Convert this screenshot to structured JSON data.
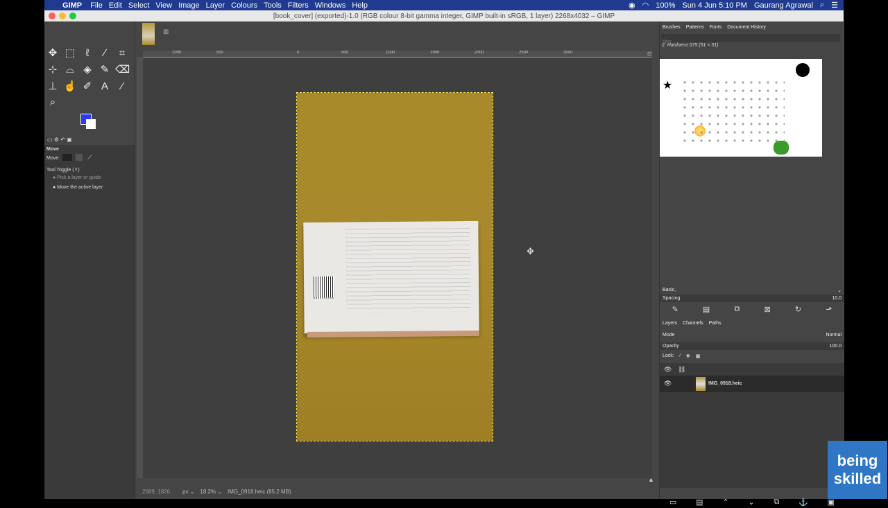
{
  "menubar": {
    "app": "GIMP",
    "items": [
      "File",
      "Edit",
      "Select",
      "View",
      "Image",
      "Layer",
      "Colours",
      "Tools",
      "Filters",
      "Windows",
      "Help"
    ],
    "battery": "100%",
    "datetime": "Sun 4 Jun  5:10 PM",
    "user": "Gaurang Agrawal"
  },
  "window": {
    "title": "[book_cover] (exported)-1.0 (RGB colour 8-bit gamma integer, GIMP built-in sRGB, 1 layer) 2268x4032 – GIMP"
  },
  "toolbox": {
    "fg_color": "#2a3bf0",
    "bg_color": "#ffffff",
    "options_title": "Move",
    "move_label": "Move:",
    "tool_toggle": "Tool Toggle  (⇧)",
    "radio1": "Pick a layer or guide",
    "radio2": "Move the active layer"
  },
  "ruler": {
    "marks": [
      "1000",
      "500",
      "0",
      "500",
      "1000",
      "1500",
      "2000",
      "2500",
      "3000"
    ]
  },
  "statusbar": {
    "coords": "2689, 1826",
    "unit": "px",
    "zoom": "18.2%",
    "file": "IMG_0918.heic (85.2 MB)"
  },
  "dock": {
    "tabs": [
      "Brushes",
      "Patterns",
      "Fonts",
      "Document History"
    ],
    "filter_placeholder": "filter",
    "brush_name": "2. Hardness 075 (51 × 51)",
    "preset": "Basic,",
    "spacing_label": "Spacing",
    "spacing_value": "10.0",
    "layer_tabs": [
      "Layers",
      "Channels",
      "Paths"
    ],
    "mode_label": "Mode",
    "mode_value": "Normal",
    "opacity_label": "Opacity",
    "opacity_value": "100.0",
    "lock_label": "Lock:",
    "layer_name": "IMG_0918.heic"
  },
  "watermark": {
    "line1": "being",
    "line2": "skilled"
  }
}
